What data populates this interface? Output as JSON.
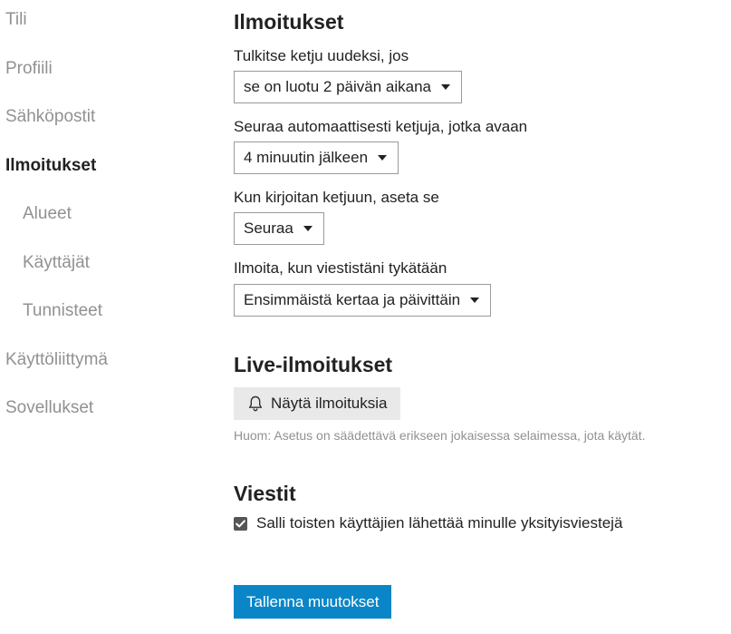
{
  "sidebar": {
    "items": [
      {
        "label": "Tili"
      },
      {
        "label": "Profiili"
      },
      {
        "label": "Sähköpostit"
      },
      {
        "label": "Ilmoitukset"
      },
      {
        "label": "Alueet"
      },
      {
        "label": "Käyttäjät"
      },
      {
        "label": "Tunnisteet"
      },
      {
        "label": "Käyttöliittymä"
      },
      {
        "label": "Sovellukset"
      }
    ],
    "active_item": "Ilmoitukset"
  },
  "notifications": {
    "title": "Ilmoitukset",
    "new_topic_label": "Tulkitse ketju uudeksi, jos",
    "new_topic_value": "se on luotu 2 päivän aikana",
    "auto_track_label": "Seuraa automaattisesti ketjuja, jotka avaan",
    "auto_track_value": "4 minuutin jälkeen",
    "reply_label": "Kun kirjoitan ketjuun, aseta se",
    "reply_value": "Seuraa",
    "like_label": "Ilmoita, kun viestistäni tykätään",
    "like_value": "Ensimmäistä kertaa ja päivittäin"
  },
  "live": {
    "title": "Live-ilmoitukset",
    "button_label": "Näytä ilmoituksia",
    "button_icon": "bell-icon",
    "hint": "Huom: Asetus on säädettävä erikseen jokaisessa selaimessa, jota käytät."
  },
  "messages": {
    "title": "Viestit",
    "allow_pm_label": "Salli toisten käyttäjien lähettää minulle yksityisviestejä",
    "allow_pm_checked": true
  },
  "save_label": "Tallenna muutokset",
  "colors": {
    "primary": "#0a86c8",
    "muted_text": "#919191",
    "text": "#222222",
    "button_bg": "#e9e9e9"
  }
}
